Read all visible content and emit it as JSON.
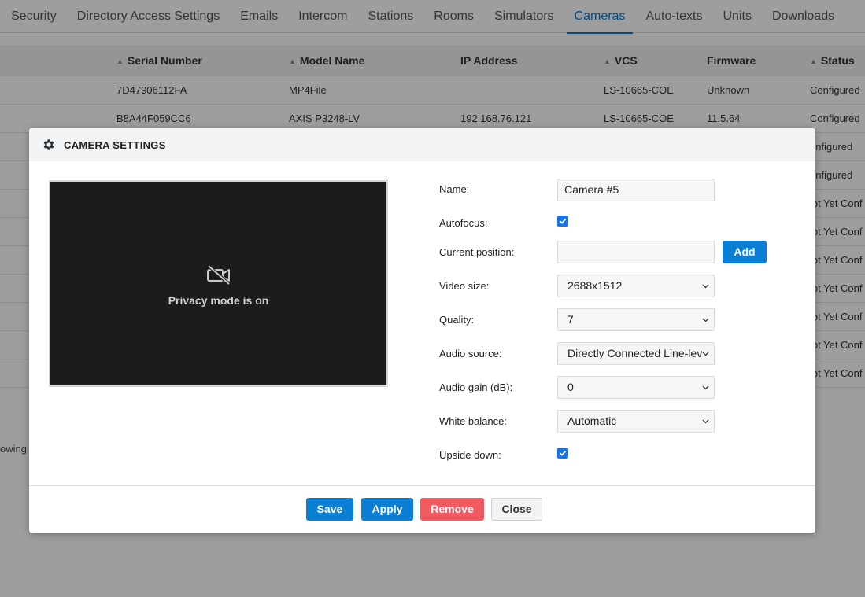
{
  "tabs": [
    {
      "label": "Security"
    },
    {
      "label": "Directory Access Settings"
    },
    {
      "label": "Emails"
    },
    {
      "label": "Intercom"
    },
    {
      "label": "Stations"
    },
    {
      "label": "Rooms"
    },
    {
      "label": "Simulators"
    },
    {
      "label": "Cameras",
      "active": true
    },
    {
      "label": "Auto-texts"
    },
    {
      "label": "Units"
    },
    {
      "label": "Downloads"
    }
  ],
  "table": {
    "headers": {
      "serial": "Serial Number",
      "model": "Model Name",
      "ip": "IP Address",
      "vcs": "VCS",
      "firmware": "Firmware",
      "status": "Status"
    },
    "rows": [
      {
        "serial": "7D47906112FA",
        "model": "MP4File",
        "ip": "",
        "vcs": "LS-10665-COE",
        "firmware": "Unknown",
        "status": "Configured"
      },
      {
        "serial": "B8A44F059CC6",
        "model": "AXIS P3248-LV",
        "ip": "192.168.76.121",
        "vcs": "LS-10665-COE",
        "firmware": "11.5.64",
        "status": "Configured"
      },
      {
        "serial": "",
        "model": "",
        "ip": "",
        "vcs": "",
        "firmware": "",
        "status": "onfigured"
      },
      {
        "serial": "",
        "model": "",
        "ip": "",
        "vcs": "",
        "firmware": "",
        "status": "onfigured"
      },
      {
        "serial": "",
        "model": "",
        "ip": "",
        "vcs": "",
        "firmware": "",
        "status": "lot Yet Conf"
      },
      {
        "serial": "",
        "model": "",
        "ip": "",
        "vcs": "",
        "firmware": "",
        "status": "lot Yet Conf"
      },
      {
        "serial": "",
        "model": "",
        "ip": "",
        "vcs": "",
        "firmware": "",
        "status": "lot Yet Conf"
      },
      {
        "serial": "",
        "model": "",
        "ip": "",
        "vcs": "",
        "firmware": "",
        "status": "lot Yet Conf"
      },
      {
        "serial": "",
        "model": "",
        "ip": "",
        "vcs": "",
        "firmware": "",
        "status": "lot Yet Conf"
      },
      {
        "serial": "",
        "model": "",
        "ip": "",
        "vcs": "",
        "firmware": "",
        "status": "lot Yet Conf"
      },
      {
        "serial": "",
        "model": "",
        "ip": "",
        "vcs": "",
        "firmware": "",
        "status": "lot Yet Conf"
      }
    ],
    "showing_text": "owing"
  },
  "modal": {
    "title": "CAMERA SETTINGS",
    "header_icon": "gear-icon",
    "preview": {
      "icon": "camera-off-icon",
      "message": "Privacy mode is on"
    },
    "fields": {
      "name": {
        "label": "Name:",
        "value": "Camera #5"
      },
      "autofocus": {
        "label": "Autofocus:",
        "checked": true
      },
      "current_position": {
        "label": "Current position:",
        "value": "",
        "add_label": "Add"
      },
      "video_size": {
        "label": "Video size:",
        "value": "2688x1512"
      },
      "quality": {
        "label": "Quality:",
        "value": "7"
      },
      "audio_source": {
        "label": "Audio source:",
        "value": "Directly Connected Line-lev"
      },
      "audio_gain": {
        "label": "Audio gain (dB):",
        "value": "0"
      },
      "white_balance": {
        "label": "White balance:",
        "value": "Automatic"
      },
      "upside_down": {
        "label": "Upside down:",
        "checked": true
      }
    },
    "buttons": {
      "save": "Save",
      "apply": "Apply",
      "remove": "Remove",
      "close": "Close"
    }
  },
  "colors": {
    "accent": "#0a7fd4",
    "danger": "#f05a60",
    "checkbox": "#1a73e8"
  }
}
